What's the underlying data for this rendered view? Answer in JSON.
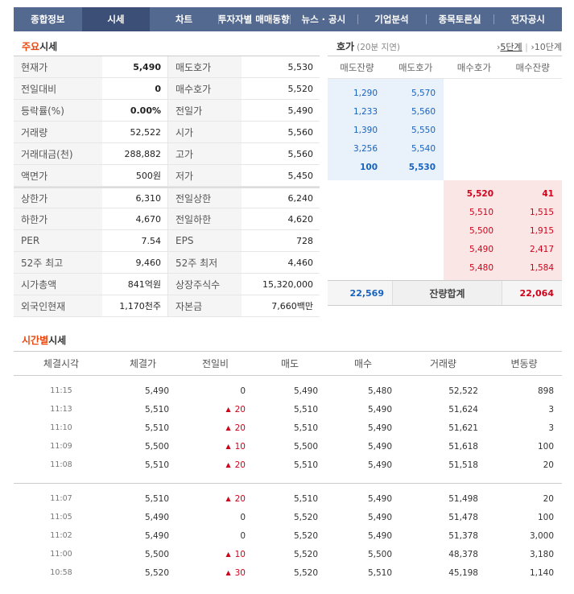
{
  "tabs": [
    "종합정보",
    "시세",
    "차트",
    "투자자별 매매동향",
    "뉴스 · 공시",
    "기업분석",
    "종목토론실",
    "전자공시"
  ],
  "main_section": {
    "title_hl": "주요",
    "title": "시세"
  },
  "info_rows": [
    {
      "l1": "현재가",
      "v1": "5,490",
      "l2": "매도호가",
      "v2": "5,530"
    },
    {
      "l1": "전일대비",
      "v1": "0",
      "l2": "매수호가",
      "v2": "5,520"
    },
    {
      "l1": "등락률(%)",
      "v1": "0.00%",
      "l2": "전일가",
      "v2": "5,490"
    },
    {
      "l1": "거래량",
      "v1": "52,522",
      "l2": "시가",
      "v2": "5,560"
    },
    {
      "l1": "거래대금(천)",
      "v1": "288,882",
      "l2": "고가",
      "v2": "5,560"
    },
    {
      "l1": "액면가",
      "v1": "500원",
      "l2": "저가",
      "v2": "5,450"
    },
    {
      "l1": "상한가",
      "v1": "6,310",
      "l2": "전일상한",
      "v2": "6,240"
    },
    {
      "l1": "하한가",
      "v1": "4,670",
      "l2": "전일하한",
      "v2": "4,620"
    },
    {
      "l1": "PER",
      "v1": "7.54",
      "l2": "EPS",
      "v2": "728"
    },
    {
      "l1": "52주 최고",
      "v1": "9,460",
      "l2": "52주 최저",
      "v2": "4,460"
    },
    {
      "l1": "시가총액",
      "v1": "841억원",
      "l2": "상장주식수",
      "v2": "15,320,000"
    },
    {
      "l1": "외국인현재",
      "v1": "1,170천주",
      "l2": "자본금",
      "v2": "7,660백만"
    }
  ],
  "orderbook": {
    "title": "호가",
    "delay": "(20분 지연)",
    "step5": "5단계",
    "sep": "|",
    "step10": "10단계",
    "headers": [
      "매도잔량",
      "매도호가",
      "매수호가",
      "매수잔량"
    ],
    "asks": [
      [
        "1,290",
        "5,570"
      ],
      [
        "1,233",
        "5,560"
      ],
      [
        "1,390",
        "5,550"
      ],
      [
        "3,256",
        "5,540"
      ],
      [
        "100",
        "5,530"
      ]
    ],
    "bids": [
      [
        "5,520",
        "41"
      ],
      [
        "5,510",
        "1,515"
      ],
      [
        "5,500",
        "1,915"
      ],
      [
        "5,490",
        "2,417"
      ],
      [
        "5,480",
        "1,584"
      ]
    ],
    "total_ask": "22,569",
    "total_label": "잔량합계",
    "total_bid": "22,064"
  },
  "time_section": {
    "title_hl": "시간별",
    "title": "시세"
  },
  "time_headers": [
    "체결시각",
    "체결가",
    "전일비",
    "매도",
    "매수",
    "거래량",
    "변동량"
  ],
  "time_groups": [
    [
      [
        "11:15",
        "5,490",
        "0",
        "5,490",
        "5,480",
        "52,522",
        "898"
      ],
      [
        "11:13",
        "5,510",
        "20",
        "5,510",
        "5,490",
        "51,624",
        "3"
      ],
      [
        "11:10",
        "5,510",
        "20",
        "5,510",
        "5,490",
        "51,621",
        "3"
      ],
      [
        "11:09",
        "5,500",
        "10",
        "5,500",
        "5,490",
        "51,618",
        "100"
      ],
      [
        "11:08",
        "5,510",
        "20",
        "5,510",
        "5,490",
        "51,518",
        "20"
      ]
    ],
    [
      [
        "11:07",
        "5,510",
        "20",
        "5,510",
        "5,490",
        "51,498",
        "20"
      ],
      [
        "11:05",
        "5,490",
        "0",
        "5,520",
        "5,490",
        "51,478",
        "100"
      ],
      [
        "11:02",
        "5,490",
        "0",
        "5,520",
        "5,490",
        "51,378",
        "3,000"
      ],
      [
        "11:00",
        "5,500",
        "10",
        "5,520",
        "5,500",
        "48,378",
        "3,180"
      ],
      [
        "10:58",
        "5,520",
        "30",
        "5,520",
        "5,510",
        "45,198",
        "1,140"
      ]
    ]
  ],
  "colors": {
    "tab_bg": "#54698f",
    "tab_active": "#3b4f77",
    "up": "#d0021b",
    "ask": "#1763c0",
    "highlight": "#e8470e"
  },
  "icons": {
    "up": "up-triangle-icon"
  }
}
